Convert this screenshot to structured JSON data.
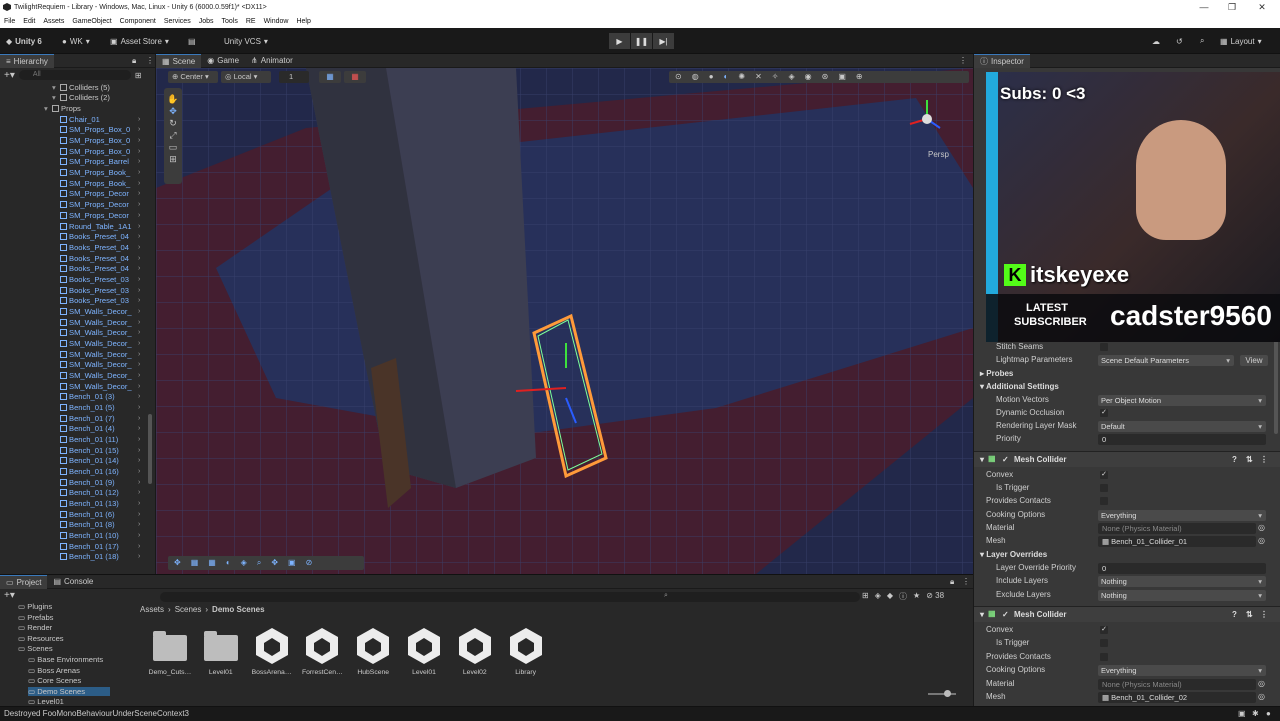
{
  "window": {
    "title": "TwilightRequiem - Library - Windows, Mac, Linux - Unity 6 (6000.0.59f1)* <DX11>",
    "controls": [
      "—",
      "❐",
      "✕"
    ]
  },
  "menu": [
    "File",
    "Edit",
    "Assets",
    "GameObject",
    "Component",
    "Services",
    "Jobs",
    "Tools",
    "RE",
    "Window",
    "Help"
  ],
  "toolbar": {
    "unity": "Unity 6",
    "account": "WK",
    "asset_store": "Asset Store",
    "vcs": "Unity VCS",
    "layout": "Layout"
  },
  "hierarchy": {
    "tab": "Hierarchy",
    "search_placeholder": "All",
    "rows": [
      {
        "label": "Colliders (5)",
        "indent": 60,
        "grey": true
      },
      {
        "label": "Colliders (2)",
        "indent": 60,
        "grey": true
      },
      {
        "label": "Props",
        "indent": 52,
        "grey": true
      },
      {
        "label": "Chair_01",
        "indent": 60
      },
      {
        "label": "SM_Props_Box_0",
        "indent": 60
      },
      {
        "label": "SM_Props_Box_0",
        "indent": 60
      },
      {
        "label": "SM_Props_Box_0",
        "indent": 60
      },
      {
        "label": "SM_Props_Barrel",
        "indent": 60
      },
      {
        "label": "SM_Props_Book_",
        "indent": 60
      },
      {
        "label": "SM_Props_Book_",
        "indent": 60
      },
      {
        "label": "SM_Props_Decor",
        "indent": 60
      },
      {
        "label": "SM_Props_Decor",
        "indent": 60
      },
      {
        "label": "SM_Props_Decor",
        "indent": 60
      },
      {
        "label": "Round_Table_1A1",
        "indent": 60
      },
      {
        "label": "Books_Preset_04",
        "indent": 60
      },
      {
        "label": "Books_Preset_04",
        "indent": 60
      },
      {
        "label": "Books_Preset_04",
        "indent": 60
      },
      {
        "label": "Books_Preset_04",
        "indent": 60
      },
      {
        "label": "Books_Preset_03",
        "indent": 60
      },
      {
        "label": "Books_Preset_03",
        "indent": 60
      },
      {
        "label": "Books_Preset_03",
        "indent": 60
      },
      {
        "label": "SM_Walls_Decor_",
        "indent": 60
      },
      {
        "label": "SM_Walls_Decor_",
        "indent": 60
      },
      {
        "label": "SM_Walls_Decor_",
        "indent": 60
      },
      {
        "label": "SM_Walls_Decor_",
        "indent": 60
      },
      {
        "label": "SM_Walls_Decor_",
        "indent": 60
      },
      {
        "label": "SM_Walls_Decor_",
        "indent": 60
      },
      {
        "label": "SM_Walls_Decor_",
        "indent": 60
      },
      {
        "label": "SM_Walls_Decor_",
        "indent": 60
      },
      {
        "label": "Bench_01 (3)",
        "indent": 60
      },
      {
        "label": "Bench_01 (5)",
        "indent": 60
      },
      {
        "label": "Bench_01 (7)",
        "indent": 60
      },
      {
        "label": "Bench_01 (4)",
        "indent": 60
      },
      {
        "label": "Bench_01 (11)",
        "indent": 60
      },
      {
        "label": "Bench_01 (15)",
        "indent": 60
      },
      {
        "label": "Bench_01 (14)",
        "indent": 60
      },
      {
        "label": "Bench_01 (16)",
        "indent": 60
      },
      {
        "label": "Bench_01 (9)",
        "indent": 60
      },
      {
        "label": "Bench_01 (12)",
        "indent": 60
      },
      {
        "label": "Bench_01 (13)",
        "indent": 60
      },
      {
        "label": "Bench_01 (6)",
        "indent": 60
      },
      {
        "label": "Bench_01 (8)",
        "indent": 60
      },
      {
        "label": "Bench_01 (10)",
        "indent": 60
      },
      {
        "label": "Bench_01 (17)",
        "indent": 60
      },
      {
        "label": "Bench_01 (18)",
        "indent": 60
      }
    ]
  },
  "scene": {
    "tabs": [
      "Scene",
      "Game",
      "Animator"
    ],
    "pivot": "Center",
    "space": "Local",
    "snap": "1",
    "persp": "Persp"
  },
  "project": {
    "tabs": [
      "Project",
      "Console"
    ],
    "breadcrumb": [
      "Assets",
      "Scenes",
      "Demo Scenes"
    ],
    "count": "38",
    "tree": [
      "Plugins",
      "Prefabs",
      "Render",
      "Resources",
      "Scenes",
      "Base Environments",
      "Boss Arenas",
      "Core Scenes",
      "Demo Scenes",
      "Level01"
    ],
    "assets": [
      {
        "name": "Demo_Cuts…",
        "kind": "folder"
      },
      {
        "name": "Level01",
        "kind": "folder"
      },
      {
        "name": "BossArena…",
        "kind": "scene"
      },
      {
        "name": "ForrestCen…",
        "kind": "scene"
      },
      {
        "name": "HubScene",
        "kind": "scene"
      },
      {
        "name": "Level01",
        "kind": "scene"
      },
      {
        "name": "Level02",
        "kind": "scene"
      },
      {
        "name": "Library",
        "kind": "scene"
      }
    ]
  },
  "inspector": {
    "tab": "Inspector",
    "stitch_seams": "Stitch Seams",
    "lightmap_parameters": "Lightmap Parameters",
    "lightmap_value": "Scene Default Parameters",
    "view": "View",
    "probes": "Probes",
    "additional_settings": "Additional Settings",
    "motion_vectors": "Motion Vectors",
    "motion_vectors_value": "Per Object Motion",
    "dynamic_occlusion": "Dynamic Occlusion",
    "rendering_layer_mask": "Rendering Layer Mask",
    "rendering_layer_value": "Default",
    "priority": "Priority",
    "priority_value": "0",
    "mesh_collider": "Mesh Collider",
    "convex": "Convex",
    "is_trigger": "Is Trigger",
    "provides_contacts": "Provides Contacts",
    "cooking_options": "Cooking Options",
    "cooking_value": "Everything",
    "material": "Material",
    "material_value": "None (Physics Material)",
    "mesh": "Mesh",
    "mesh_value_1": "Bench_01_Collider_01",
    "mesh_value_2": "Bench_01_Collider_02",
    "layer_overrides": "Layer Overrides",
    "layer_override_priority": "Layer Override Priority",
    "layer_override_priority_value": "0",
    "include_layers": "Include Layers",
    "exclude_layers": "Exclude Layers",
    "nothing": "Nothing"
  },
  "overlay": {
    "subs": "Subs: 0 <3",
    "brand": "itskeyexe",
    "latest": "LATEST",
    "subscriber": "SUBSCRIBER",
    "name": "cadster9560"
  },
  "status": {
    "message": "Destroyed FooMonoBehaviourUnderSceneContext3"
  }
}
